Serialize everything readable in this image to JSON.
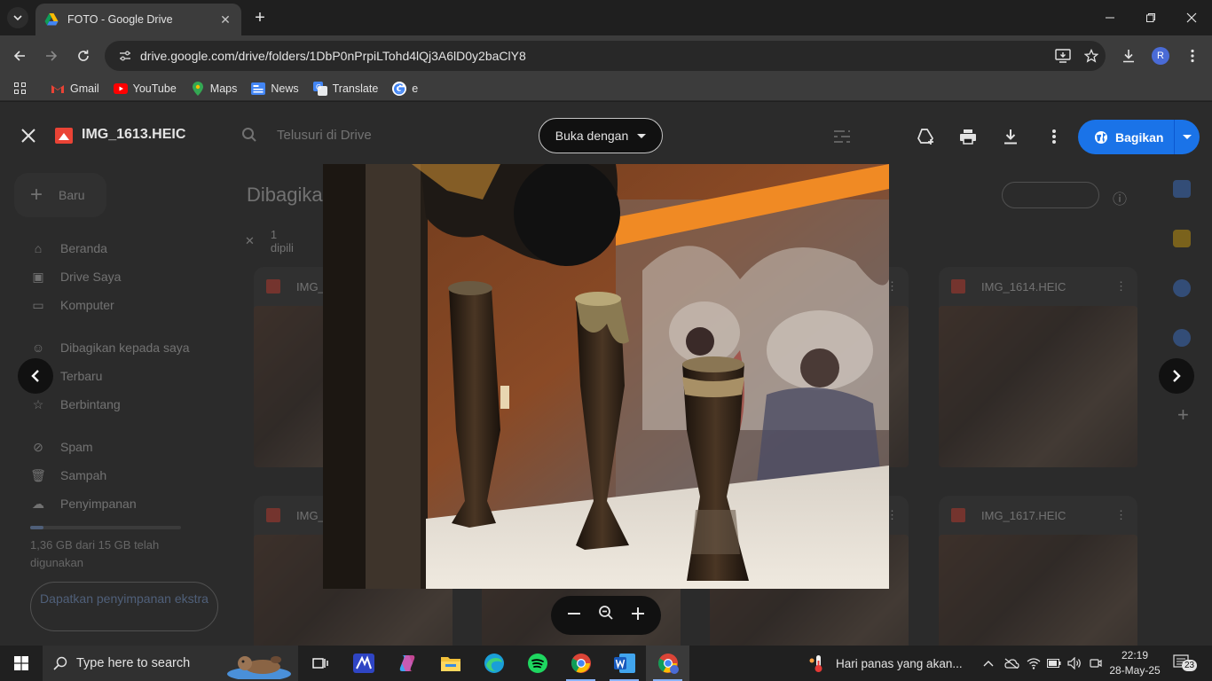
{
  "browser": {
    "tab_title": "FOTO - Google Drive",
    "url": "drive.google.com/drive/folders/1DbP0nPrpiLTohd4lQj3A6lD0y2baClY8",
    "profile_initial": "R",
    "bookmarks": [
      {
        "label": "Gmail",
        "icon": "gmail-icon"
      },
      {
        "label": "YouTube",
        "icon": "youtube-icon"
      },
      {
        "label": "Maps",
        "icon": "maps-icon"
      },
      {
        "label": "News",
        "icon": "news-icon"
      },
      {
        "label": "Translate",
        "icon": "translate-icon"
      },
      {
        "label": "e",
        "icon": "google-icon"
      }
    ]
  },
  "drive": {
    "new_button": "Baru",
    "nav": [
      {
        "label": "Beranda",
        "icon": "home-icon"
      },
      {
        "label": "Drive Saya",
        "icon": "my-drive-icon"
      },
      {
        "label": "Komputer",
        "icon": "computer-icon"
      },
      {
        "label": "Dibagikan kepada saya",
        "icon": "shared-icon"
      },
      {
        "label": "Terbaru",
        "icon": "recent-icon"
      },
      {
        "label": "Berbintang",
        "icon": "star-icon"
      },
      {
        "label": "Spam",
        "icon": "spam-icon"
      },
      {
        "label": "Sampah",
        "icon": "trash-icon"
      },
      {
        "label": "Penyimpanan",
        "icon": "cloud-icon"
      }
    ],
    "storage_text": "1,36 GB dari 15 GB telah digunakan",
    "storage_fraction": 0.09,
    "storage_button": "Dapatkan penyimpanan ekstra",
    "page_title": "Dibagika",
    "selection_text": "1 dipili",
    "files": [
      {
        "name": "IMG_"
      },
      {
        "name": "IMG_1614.HEIC"
      },
      {
        "name": "IMG_"
      },
      {
        "name": "IMG_1617.HEIC"
      }
    ]
  },
  "viewer": {
    "file_name": "IMG_1613.HEIC",
    "search_placeholder": "Telusuri di Drive",
    "open_with": "Buka dengan",
    "share": "Bagikan"
  },
  "taskbar": {
    "search_placeholder": "Type here to search",
    "weather_text": "Hari panas yang akan...",
    "time": "22:19",
    "date": "28-May-25",
    "notifications": "23"
  },
  "colors": {
    "accent_blue": "#1a73e8",
    "file_red": "#ea4335",
    "tab_bg": "#3c3c3c"
  }
}
